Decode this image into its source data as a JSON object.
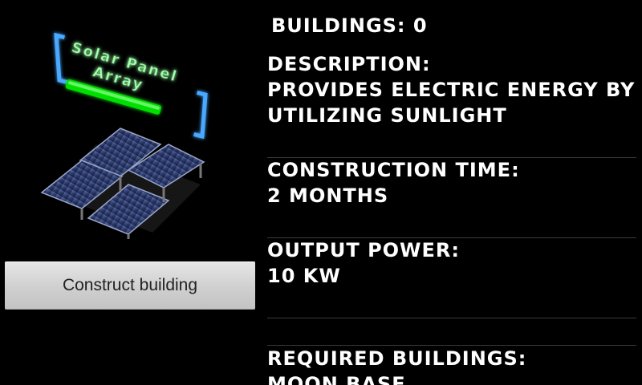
{
  "buildings_label": "Buildings: 0",
  "building_name_lines": [
    "Solar Panel",
    "Array"
  ],
  "description": {
    "label": "Description:",
    "lines": [
      "Provides electric energy by",
      "utilizing sunlight"
    ]
  },
  "construction_time": {
    "label": "Construction time:",
    "value": "2 months"
  },
  "output_power": {
    "label": "Output power:",
    "value": "10 kW"
  },
  "required_buildings": {
    "label": "Required buildings:",
    "value": "Moon base"
  },
  "construct_button_label": "Construct building",
  "colors": {
    "background": "#000000",
    "text": "#ffffff",
    "accent_cyan": "#4aa8ff",
    "name_green": "#a8ffb0",
    "bar_green": "#00e000"
  },
  "icons": {
    "art": "solar-panel-array-icon"
  }
}
